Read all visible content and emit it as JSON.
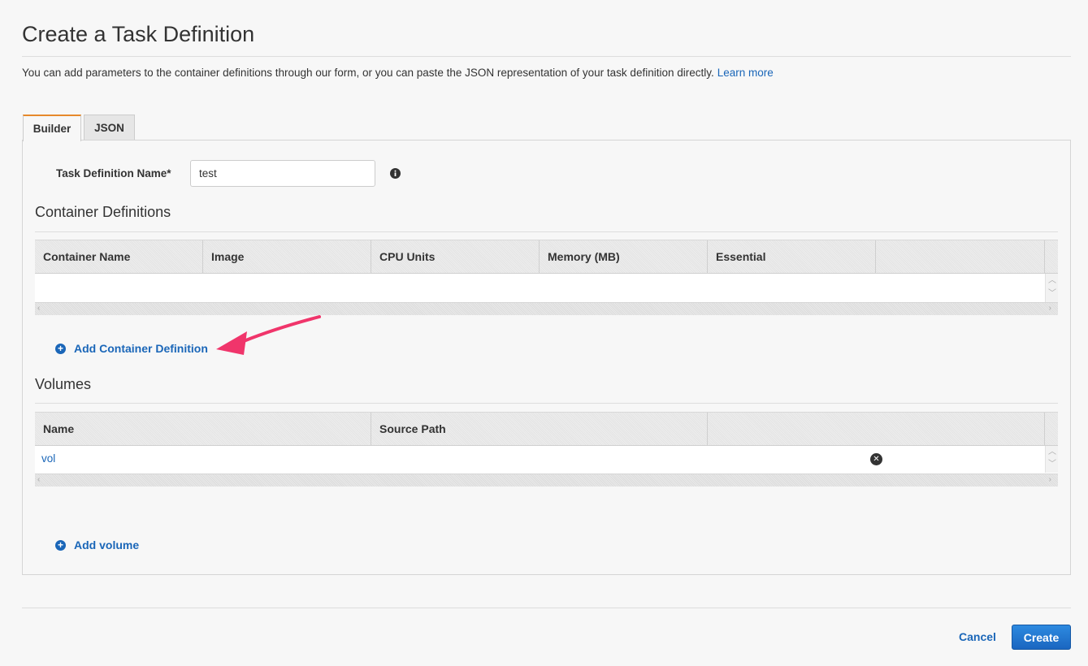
{
  "page": {
    "title": "Create a Task Definition",
    "intro": "You can add parameters to the container definitions through our form, or you can paste the JSON representation of your task definition directly.",
    "learn_more": "Learn more"
  },
  "tabs": [
    {
      "label": "Builder",
      "active": true
    },
    {
      "label": "JSON",
      "active": false
    }
  ],
  "task_name": {
    "label": "Task Definition Name*",
    "value": "test",
    "info_icon": "info-icon"
  },
  "containers": {
    "title": "Container Definitions",
    "columns": [
      "Container Name",
      "Image",
      "CPU Units",
      "Memory (MB)",
      "Essential",
      ""
    ],
    "rows": [],
    "add_label": "Add Container Definition",
    "add_icon": "plus-circle-icon"
  },
  "volumes": {
    "title": "Volumes",
    "columns": [
      "Name",
      "Source Path",
      ""
    ],
    "rows": [
      {
        "name": "vol",
        "source_path": ""
      }
    ],
    "remove_icon": "remove-circle-icon",
    "add_label": "Add volume",
    "add_icon": "plus-circle-icon"
  },
  "footer": {
    "cancel_label": "Cancel",
    "create_label": "Create"
  },
  "colors": {
    "link": "#1a66b8",
    "tab_accent": "#e6892b",
    "primary_button": "#1a66c0",
    "annotation_arrow": "#f0356b"
  }
}
